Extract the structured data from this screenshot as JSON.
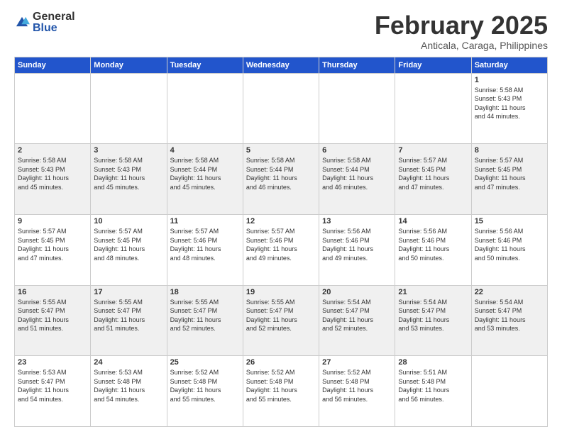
{
  "logo": {
    "general": "General",
    "blue": "Blue"
  },
  "header": {
    "month": "February 2025",
    "location": "Anticala, Caraga, Philippines"
  },
  "weekdays": [
    "Sunday",
    "Monday",
    "Tuesday",
    "Wednesday",
    "Thursday",
    "Friday",
    "Saturday"
  ],
  "weeks": [
    [
      {
        "day": "",
        "info": ""
      },
      {
        "day": "",
        "info": ""
      },
      {
        "day": "",
        "info": ""
      },
      {
        "day": "",
        "info": ""
      },
      {
        "day": "",
        "info": ""
      },
      {
        "day": "",
        "info": ""
      },
      {
        "day": "1",
        "info": "Sunrise: 5:58 AM\nSunset: 5:43 PM\nDaylight: 11 hours\nand 44 minutes."
      }
    ],
    [
      {
        "day": "2",
        "info": "Sunrise: 5:58 AM\nSunset: 5:43 PM\nDaylight: 11 hours\nand 45 minutes."
      },
      {
        "day": "3",
        "info": "Sunrise: 5:58 AM\nSunset: 5:43 PM\nDaylight: 11 hours\nand 45 minutes."
      },
      {
        "day": "4",
        "info": "Sunrise: 5:58 AM\nSunset: 5:44 PM\nDaylight: 11 hours\nand 45 minutes."
      },
      {
        "day": "5",
        "info": "Sunrise: 5:58 AM\nSunset: 5:44 PM\nDaylight: 11 hours\nand 46 minutes."
      },
      {
        "day": "6",
        "info": "Sunrise: 5:58 AM\nSunset: 5:44 PM\nDaylight: 11 hours\nand 46 minutes."
      },
      {
        "day": "7",
        "info": "Sunrise: 5:57 AM\nSunset: 5:45 PM\nDaylight: 11 hours\nand 47 minutes."
      },
      {
        "day": "8",
        "info": "Sunrise: 5:57 AM\nSunset: 5:45 PM\nDaylight: 11 hours\nand 47 minutes."
      }
    ],
    [
      {
        "day": "9",
        "info": "Sunrise: 5:57 AM\nSunset: 5:45 PM\nDaylight: 11 hours\nand 47 minutes."
      },
      {
        "day": "10",
        "info": "Sunrise: 5:57 AM\nSunset: 5:45 PM\nDaylight: 11 hours\nand 48 minutes."
      },
      {
        "day": "11",
        "info": "Sunrise: 5:57 AM\nSunset: 5:46 PM\nDaylight: 11 hours\nand 48 minutes."
      },
      {
        "day": "12",
        "info": "Sunrise: 5:57 AM\nSunset: 5:46 PM\nDaylight: 11 hours\nand 49 minutes."
      },
      {
        "day": "13",
        "info": "Sunrise: 5:56 AM\nSunset: 5:46 PM\nDaylight: 11 hours\nand 49 minutes."
      },
      {
        "day": "14",
        "info": "Sunrise: 5:56 AM\nSunset: 5:46 PM\nDaylight: 11 hours\nand 50 minutes."
      },
      {
        "day": "15",
        "info": "Sunrise: 5:56 AM\nSunset: 5:46 PM\nDaylight: 11 hours\nand 50 minutes."
      }
    ],
    [
      {
        "day": "16",
        "info": "Sunrise: 5:55 AM\nSunset: 5:47 PM\nDaylight: 11 hours\nand 51 minutes."
      },
      {
        "day": "17",
        "info": "Sunrise: 5:55 AM\nSunset: 5:47 PM\nDaylight: 11 hours\nand 51 minutes."
      },
      {
        "day": "18",
        "info": "Sunrise: 5:55 AM\nSunset: 5:47 PM\nDaylight: 11 hours\nand 52 minutes."
      },
      {
        "day": "19",
        "info": "Sunrise: 5:55 AM\nSunset: 5:47 PM\nDaylight: 11 hours\nand 52 minutes."
      },
      {
        "day": "20",
        "info": "Sunrise: 5:54 AM\nSunset: 5:47 PM\nDaylight: 11 hours\nand 52 minutes."
      },
      {
        "day": "21",
        "info": "Sunrise: 5:54 AM\nSunset: 5:47 PM\nDaylight: 11 hours\nand 53 minutes."
      },
      {
        "day": "22",
        "info": "Sunrise: 5:54 AM\nSunset: 5:47 PM\nDaylight: 11 hours\nand 53 minutes."
      }
    ],
    [
      {
        "day": "23",
        "info": "Sunrise: 5:53 AM\nSunset: 5:47 PM\nDaylight: 11 hours\nand 54 minutes."
      },
      {
        "day": "24",
        "info": "Sunrise: 5:53 AM\nSunset: 5:48 PM\nDaylight: 11 hours\nand 54 minutes."
      },
      {
        "day": "25",
        "info": "Sunrise: 5:52 AM\nSunset: 5:48 PM\nDaylight: 11 hours\nand 55 minutes."
      },
      {
        "day": "26",
        "info": "Sunrise: 5:52 AM\nSunset: 5:48 PM\nDaylight: 11 hours\nand 55 minutes."
      },
      {
        "day": "27",
        "info": "Sunrise: 5:52 AM\nSunset: 5:48 PM\nDaylight: 11 hours\nand 56 minutes."
      },
      {
        "day": "28",
        "info": "Sunrise: 5:51 AM\nSunset: 5:48 PM\nDaylight: 11 hours\nand 56 minutes."
      },
      {
        "day": "",
        "info": ""
      }
    ]
  ]
}
